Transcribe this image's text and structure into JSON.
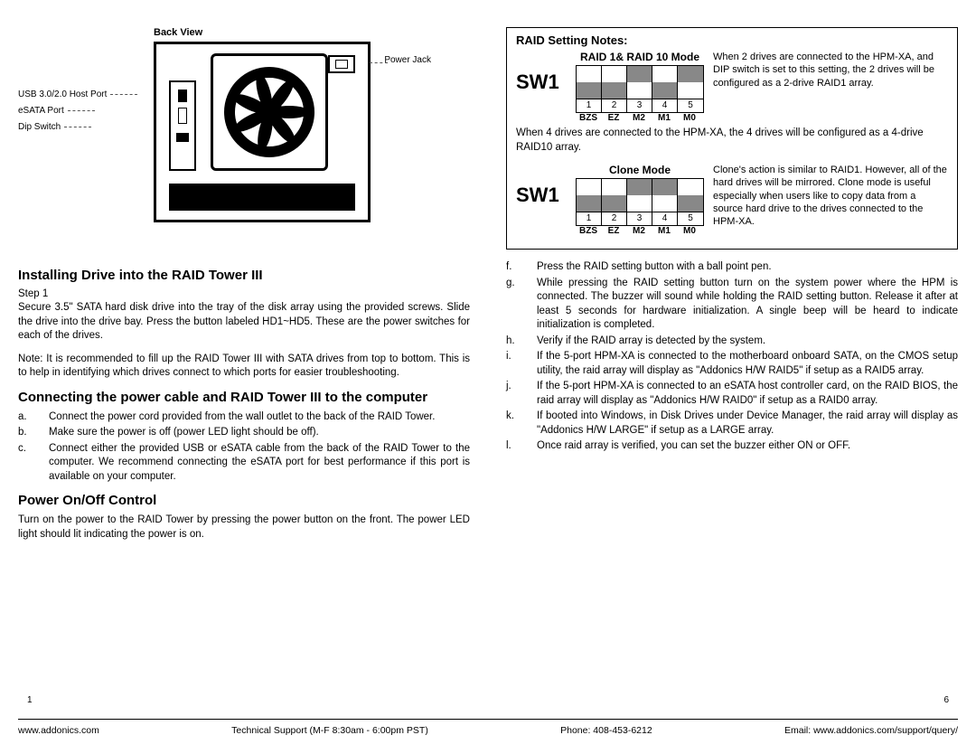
{
  "left": {
    "back_view": "Back View",
    "labels": {
      "usb": "USB 3.0/2.0 Host Port",
      "esata": "eSATA Port",
      "dip": "Dip Switch",
      "power_jack": "Power Jack"
    },
    "h_install": "Installing Drive into the RAID Tower III",
    "step1_label": "Step 1",
    "step1_body": "Secure 3.5\" SATA hard disk drive into the tray of the disk array using the provided screws. Slide the drive into the drive bay. Press the button labeled HD1~HD5. These are the power switches for each of the drives.",
    "note": "Note: It is recommended to fill up the RAID Tower III with SATA drives from top to bottom. This is to help in identifying which drives connect to which ports for easier troubleshooting.",
    "h_connect": "Connecting the power cable and RAID Tower III to the computer",
    "connect_list": [
      {
        "m": "a.",
        "t": "Connect the power cord provided from the wall outlet to the back of the RAID Tower."
      },
      {
        "m": "b.",
        "t": "Make sure the power is off (power LED light should be off)."
      },
      {
        "m": "c.",
        "t": "Connect either the provided USB or eSATA cable from the back of the RAID Tower to the computer. We recommend connecting the eSATA port for best performance if this port is available on your computer."
      }
    ],
    "h_power": "Power On/Off Control",
    "power_body": "Turn on the power to the RAID Tower by pressing the power button on the front. The power LED light should lit indicating the power is on.",
    "page_num": "1"
  },
  "right": {
    "notes_title": "RAID Setting Notes:",
    "sw1": "SW1",
    "dip1": {
      "title": "RAID 1& RAID 10 Mode",
      "positions": [
        "down",
        "down",
        "up",
        "down",
        "up"
      ],
      "nums": [
        "1",
        "2",
        "3",
        "4",
        "5"
      ],
      "labels": [
        "BZS",
        "EZ",
        "M2",
        "M1",
        "M0"
      ],
      "desc": "When 2 drives are connected to the HPM-XA, and DIP switch is set to this setting, the 2 drives will be configured as a 2-drive RAID1 array."
    },
    "dip1_span": "When 4 drives are connected to the HPM-XA, the 4 drives will be configured as a 4-drive RAID10 array.",
    "dip2": {
      "title": "Clone Mode",
      "positions": [
        "down",
        "down",
        "up",
        "up",
        "down"
      ],
      "nums": [
        "1",
        "2",
        "3",
        "4",
        "5"
      ],
      "labels": [
        "BZS",
        "EZ",
        "M2",
        "M1",
        "M0"
      ],
      "desc": "Clone's action is similar to RAID1. However, all of the hard drives will be mirrored. Clone mode is useful especially when users like to copy data from a source hard drive to the drives connected to the HPM-XA."
    },
    "steps": [
      {
        "m": "f.",
        "t": "Press the RAID setting button with a ball point pen."
      },
      {
        "m": "g.",
        "t": "While pressing the RAID setting button turn on the system power where the HPM is connected. The buzzer will sound while holding the RAID setting button. Release it after at least 5 seconds for hardware initialization. A single beep will be heard to indicate initialization is completed."
      },
      {
        "m": "h.",
        "t": "Verify if the RAID array is detected by the system."
      },
      {
        "m": "i.",
        "t": "If the 5-port HPM-XA is connected to the motherboard onboard SATA, on the CMOS setup utility, the raid array will display as \"Addonics H/W RAID5\" if setup as a RAID5 array."
      },
      {
        "m": "j.",
        "t": "If the 5-port HPM-XA is connected to an eSATA host controller card, on the RAID BIOS, the raid array will display as \"Addonics H/W RAID0\" if setup as a RAID0 array."
      },
      {
        "m": "k.",
        "t": "If booted into Windows, in Disk Drives under Device Manager, the raid array will display as \"Addonics H/W LARGE\" if setup as a LARGE array."
      },
      {
        "m": "l.",
        "t": "Once raid array is verified, you can set the buzzer either ON or OFF."
      }
    ],
    "page_num": "6"
  },
  "footer": {
    "site": "www.addonics.com",
    "tech": "Technical Support (M-F 8:30am - 6:00pm PST)",
    "phone": "Phone: 408-453-6212",
    "email": "Email: www.addonics.com/support/query/"
  }
}
